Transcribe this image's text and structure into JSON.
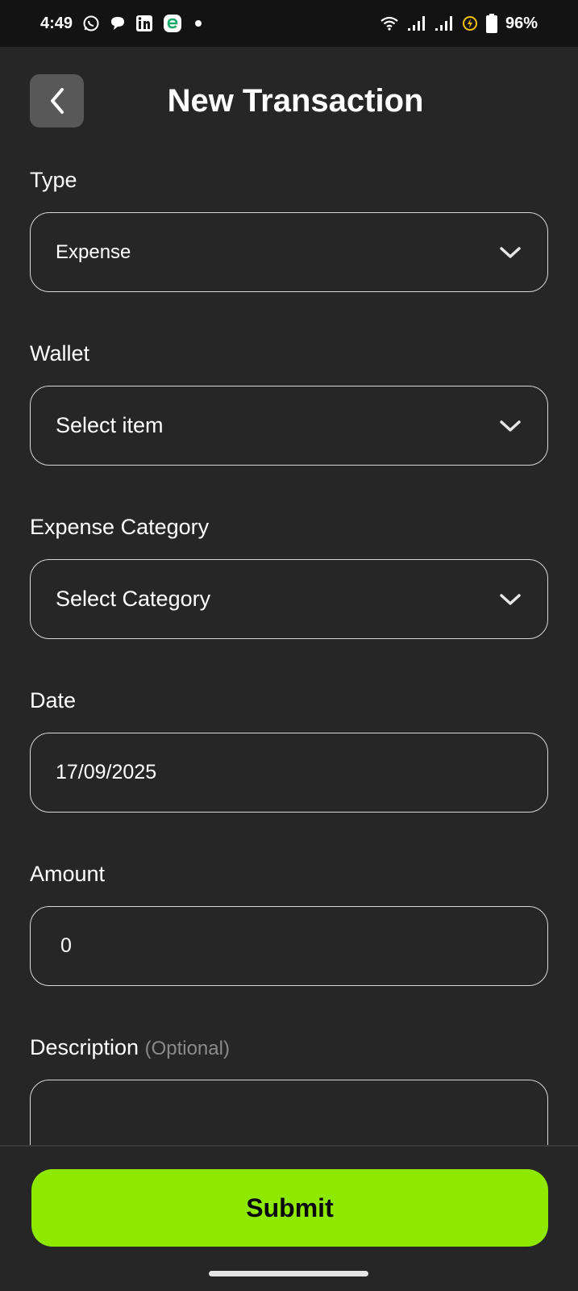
{
  "status_bar": {
    "time": "4:49",
    "battery": "96%",
    "icons": [
      "whatsapp-icon",
      "chat-bubble-icon",
      "linkedin-icon",
      "app-e-icon",
      "notification-dot-icon",
      "wifi-icon",
      "signal-icon",
      "signal-icon",
      "battery-saver-icon",
      "battery-icon"
    ]
  },
  "header": {
    "title": "New Transaction",
    "back_icon": "chevron-left-icon"
  },
  "form": {
    "type": {
      "label": "Type",
      "value": "Expense"
    },
    "wallet": {
      "label": "Wallet",
      "value": "Select item"
    },
    "category": {
      "label": "Expense Category",
      "value": "Select Category"
    },
    "date": {
      "label": "Date",
      "value": "17/09/2025"
    },
    "amount": {
      "label": "Amount",
      "value": "0"
    },
    "description": {
      "label": "Description",
      "optional": "(Optional)",
      "value": ""
    }
  },
  "submit": {
    "label": "Submit"
  },
  "colors": {
    "background": "#262626",
    "status_bar": "#131313",
    "accent": "#8fe800",
    "border": "#d8d8d8",
    "back_button": "#585858"
  }
}
